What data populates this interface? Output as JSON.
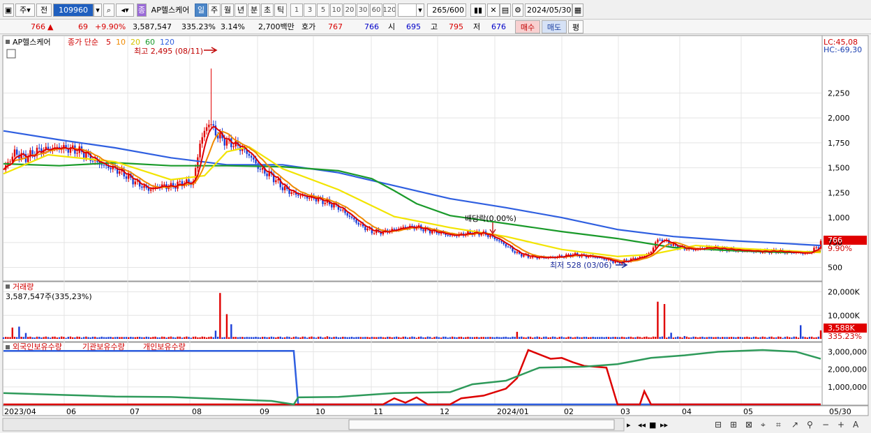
{
  "toolbar": {
    "market": "주",
    "prev": "전",
    "code": "109960",
    "stock_badge": "종",
    "stock_name": "AP헬스케어",
    "periods": [
      "일",
      "주",
      "월",
      "년",
      "분",
      "초",
      "틱"
    ],
    "active_period": "일",
    "intervals": [
      "1",
      "3",
      "5",
      "10",
      "20",
      "30",
      "60",
      "120"
    ],
    "count_current": "265",
    "count_total": "/600",
    "date": "2024/05/30"
  },
  "quote": {
    "price": "766",
    "arrow": "▲",
    "change": "69",
    "change_pct": "+9.90%",
    "volume": "3,587,547",
    "volume_ratio": "335.23%",
    "turnover": "3.14%",
    "amount": "2,700백만",
    "hoga_label": "호가",
    "ask": "767",
    "bid": "766",
    "open_label": "시",
    "open": "695",
    "high_label": "고",
    "high": "795",
    "low_label": "저",
    "low": "676",
    "buy_btn": "매수",
    "sell_btn": "매도",
    "eval_btn": "평"
  },
  "colors": {
    "up": "#e00000",
    "down": "#1b3fd8",
    "ma5": "#dd0000",
    "ma10": "#f08a00",
    "ma20": "#f2e400",
    "ma60": "#1a9a2a",
    "ma120": "#2f5fe0",
    "foreign": "#2f5fe0",
    "inst": "#dd0000",
    "indiv": "#2e9a5a"
  },
  "chart_data": [
    {
      "type": "candlestick",
      "title": "AP헬스케어",
      "legend": {
        "label": "종가 단순",
        "periods": [
          "5",
          "10",
          "20",
          "60",
          "120"
        ]
      },
      "ylim": [
        420,
        2700
      ],
      "y_ticks": [
        "2,250",
        "2,000",
        "1,750",
        "1,500",
        "1,250",
        "1,000",
        "750",
        "500"
      ],
      "x_ticks": [
        "2023/04",
        "06",
        "07",
        "08",
        "09",
        "10",
        "11",
        "12",
        "2024/01",
        "02",
        "03",
        "04",
        "05",
        "05/30"
      ],
      "annotations": {
        "high": "최고 2,495 (08/11)",
        "low": "최저 528 (03/06)",
        "dividend": "배당락(0.00%)",
        "lc": "LC:45,08",
        "hc": "HC:-69,30"
      },
      "last_price": {
        "value": 766,
        "label": "766",
        "pct": "9.90%"
      },
      "close": [
        [
          0,
          1480
        ],
        [
          5,
          1650
        ],
        [
          10,
          1600
        ],
        [
          15,
          1670
        ],
        [
          20,
          1690
        ],
        [
          25,
          1700
        ],
        [
          30,
          1690
        ],
        [
          35,
          1660
        ],
        [
          40,
          1580
        ],
        [
          45,
          1520
        ],
        [
          50,
          1490
        ],
        [
          55,
          1420
        ],
        [
          60,
          1340
        ],
        [
          65,
          1280
        ],
        [
          70,
          1320
        ],
        [
          75,
          1310
        ],
        [
          80,
          1350
        ],
        [
          85,
          1350
        ],
        [
          88,
          1750
        ],
        [
          92,
          1960
        ],
        [
          96,
          1820
        ],
        [
          100,
          1760
        ],
        [
          105,
          1720
        ],
        [
          110,
          1630
        ],
        [
          115,
          1480
        ],
        [
          120,
          1420
        ],
        [
          125,
          1300
        ],
        [
          130,
          1240
        ],
        [
          135,
          1210
        ],
        [
          140,
          1190
        ],
        [
          145,
          1150
        ],
        [
          150,
          1100
        ],
        [
          155,
          1010
        ],
        [
          160,
          920
        ],
        [
          165,
          860
        ],
        [
          170,
          855
        ],
        [
          175,
          880
        ],
        [
          180,
          905
        ],
        [
          185,
          905
        ],
        [
          190,
          870
        ],
        [
          195,
          850
        ],
        [
          200,
          820
        ],
        [
          205,
          830
        ],
        [
          210,
          850
        ],
        [
          215,
          840
        ],
        [
          220,
          790
        ],
        [
          225,
          720
        ],
        [
          230,
          640
        ],
        [
          235,
          610
        ],
        [
          240,
          600
        ],
        [
          245,
          600
        ],
        [
          250,
          610
        ],
        [
          255,
          630
        ],
        [
          260,
          615
        ],
        [
          265,
          605
        ],
        [
          270,
          580
        ],
        [
          275,
          545
        ],
        [
          280,
          575
        ],
        [
          285,
          600
        ],
        [
          290,
          650
        ],
        [
          292,
          760
        ],
        [
          295,
          780
        ],
        [
          300,
          720
        ],
        [
          305,
          690
        ],
        [
          310,
          680
        ],
        [
          315,
          700
        ],
        [
          320,
          690
        ],
        [
          325,
          680
        ],
        [
          330,
          670
        ],
        [
          335,
          665
        ],
        [
          340,
          660
        ],
        [
          345,
          665
        ],
        [
          350,
          655
        ],
        [
          355,
          650
        ],
        [
          360,
          640
        ],
        [
          365,
          710
        ],
        [
          366,
          766
        ]
      ],
      "ma120": [
        [
          0,
          1870
        ],
        [
          25,
          1780
        ],
        [
          50,
          1700
        ],
        [
          75,
          1600
        ],
        [
          100,
          1530
        ],
        [
          125,
          1530
        ],
        [
          150,
          1450
        ],
        [
          175,
          1320
        ],
        [
          200,
          1190
        ],
        [
          225,
          1100
        ],
        [
          250,
          1000
        ],
        [
          275,
          880
        ],
        [
          300,
          810
        ],
        [
          325,
          770
        ],
        [
          350,
          740
        ],
        [
          366,
          720
        ]
      ],
      "ma60": [
        [
          0,
          1540
        ],
        [
          25,
          1520
        ],
        [
          50,
          1550
        ],
        [
          75,
          1520
        ],
        [
          100,
          1520
        ],
        [
          125,
          1510
        ],
        [
          150,
          1470
        ],
        [
          165,
          1390
        ],
        [
          175,
          1270
        ],
        [
          185,
          1140
        ],
        [
          200,
          1020
        ],
        [
          225,
          940
        ],
        [
          250,
          860
        ],
        [
          275,
          790
        ],
        [
          300,
          700
        ],
        [
          325,
          670
        ],
        [
          350,
          650
        ],
        [
          366,
          660
        ]
      ],
      "ma20": [
        [
          0,
          1440
        ],
        [
          20,
          1630
        ],
        [
          50,
          1560
        ],
        [
          75,
          1380
        ],
        [
          90,
          1420
        ],
        [
          100,
          1660
        ],
        [
          110,
          1710
        ],
        [
          125,
          1490
        ],
        [
          150,
          1280
        ],
        [
          175,
          1010
        ],
        [
          200,
          900
        ],
        [
          225,
          810
        ],
        [
          250,
          680
        ],
        [
          275,
          610
        ],
        [
          290,
          630
        ],
        [
          310,
          720
        ],
        [
          330,
          690
        ],
        [
          366,
          650
        ]
      ]
    },
    {
      "type": "bar",
      "title": "거래량",
      "value_label": "3,587,547주(335,23%)",
      "ylim": [
        0,
        24000
      ],
      "y_ticks": [
        "20,000K",
        "10,000K"
      ],
      "last": {
        "label": "3,588K",
        "pct": "335.23%"
      },
      "spikes": [
        [
          4,
          4800
        ],
        [
          7,
          5200
        ],
        [
          10,
          2500
        ],
        [
          95,
          3500
        ],
        [
          97,
          19500
        ],
        [
          100,
          10500
        ],
        [
          102,
          6200
        ],
        [
          145,
          1100
        ],
        [
          230,
          3000
        ],
        [
          293,
          15800
        ],
        [
          296,
          14800
        ],
        [
          299,
          2600
        ],
        [
          305,
          1200
        ],
        [
          357,
          5800
        ],
        [
          366,
          3600
        ]
      ]
    },
    {
      "type": "line",
      "title_series": [
        "외국인보유수량",
        "기관보유수량",
        "개인보유수량"
      ],
      "ylim": [
        0,
        3300000
      ],
      "y_ticks": [
        "3,000,000",
        "2,000,000",
        "1,000,000"
      ],
      "series": [
        {
          "name": "외국인보유수량",
          "points": [
            [
              0,
              3050000
            ],
            [
              130,
              3050000
            ],
            [
              132,
              0
            ],
            [
              366,
              0
            ]
          ]
        },
        {
          "name": "기관보유수량",
          "points": [
            [
              0,
              0
            ],
            [
              170,
              0
            ],
            [
              175,
              350000
            ],
            [
              180,
              100000
            ],
            [
              185,
              400000
            ],
            [
              190,
              0
            ],
            [
              200,
              0
            ],
            [
              205,
              350000
            ],
            [
              215,
              500000
            ],
            [
              225,
              900000
            ],
            [
              230,
              1500000
            ],
            [
              235,
              3100000
            ],
            [
              245,
              2600000
            ],
            [
              250,
              2650000
            ],
            [
              255,
              2400000
            ],
            [
              260,
              2200000
            ],
            [
              270,
              2100000
            ],
            [
              275,
              0
            ],
            [
              285,
              0
            ],
            [
              287,
              750000
            ],
            [
              290,
              0
            ],
            [
              366,
              0
            ]
          ]
        },
        {
          "name": "개인보유수량",
          "points": [
            [
              0,
              650000
            ],
            [
              25,
              550000
            ],
            [
              50,
              450000
            ],
            [
              75,
              420000
            ],
            [
              100,
              300000
            ],
            [
              120,
              200000
            ],
            [
              130,
              0
            ],
            [
              132,
              400000
            ],
            [
              150,
              430000
            ],
            [
              175,
              650000
            ],
            [
              200,
              700000
            ],
            [
              210,
              1150000
            ],
            [
              225,
              1350000
            ],
            [
              240,
              2100000
            ],
            [
              260,
              2150000
            ],
            [
              275,
              2300000
            ],
            [
              290,
              2650000
            ],
            [
              305,
              2800000
            ],
            [
              320,
              3000000
            ],
            [
              340,
              3100000
            ],
            [
              355,
              3000000
            ],
            [
              366,
              2600000
            ]
          ]
        }
      ]
    }
  ]
}
